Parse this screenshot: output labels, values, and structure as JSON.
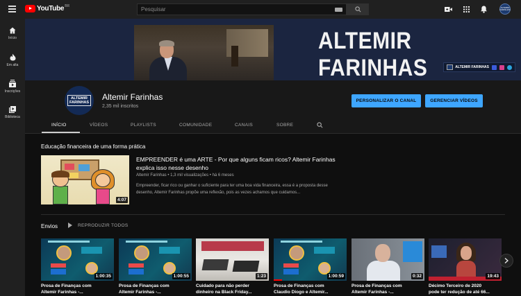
{
  "topbar": {
    "logo_text": "YouTube",
    "region": "BR",
    "search_placeholder": "Pesquisar",
    "avatar_text": "ALTEMIR FARINHAS"
  },
  "sidebar": {
    "items": [
      {
        "label": "Início",
        "icon": "home-icon"
      },
      {
        "label": "Em alta",
        "icon": "flame-icon"
      },
      {
        "label": "Inscrições",
        "icon": "subscriptions-icon"
      },
      {
        "label": "Biblioteca",
        "icon": "library-icon"
      }
    ]
  },
  "banner": {
    "name_line1": "ALTEMIR",
    "name_line2": "FARINHAS",
    "links_label": "ALTEMIR FARINHAS"
  },
  "channel": {
    "name": "Altemir Farinhas",
    "subscribers": "2,35 mil inscritos",
    "avatar_line1": "ALTEMIR",
    "avatar_line2": "FARINHAS",
    "customize_button": "PERSONALIZAR O CANAL",
    "manage_button": "GERENCIAR VÍDEOS"
  },
  "tabs": [
    "INÍCIO",
    "VÍDEOS",
    "PLAYLISTS",
    "COMUNIDADE",
    "CANAIS",
    "SOBRE"
  ],
  "featured": {
    "section_title": "Educação financeira de uma forma prática",
    "title": "EMPREENDER é uma ARTE - Por que alguns ficam ricos? Altemir Farinhas explica isso nesse desenho",
    "meta": "Altemir Farinhas • 1,3 mil visualizações • há 6 meses",
    "description_line1": "Empreender, ficar rico ou ganhar o suficiente para ter uma boa vida financeira, essa é a proposta desse",
    "description_line2": "desenho, Altemir Farinhas propõe uma reflexão, pois as vezes achamos que cuidamos...",
    "duration": "4:07"
  },
  "uploads": {
    "title": "Envios",
    "play_all": "REPRODUZIR TODOS",
    "videos": [
      {
        "title_line1": "Prosa de Finanças com",
        "title_line2": "Altemir Farinhas -...",
        "duration": "1:00:35",
        "style": "prosa"
      },
      {
        "title_line1": "Prosa de Finanças com",
        "title_line2": "Altemir Farinhas -...",
        "duration": "1:00:55",
        "style": "prosa"
      },
      {
        "title_line1": "Cuidado para não perder",
        "title_line2": "dinheiro na Black Friday...",
        "duration": "1:23",
        "style": "shop"
      },
      {
        "title_line1": "Prosa de Finanças com",
        "title_line2": "Claudio Diogo e Altemir...",
        "duration": "1:00:59",
        "style": "prosa"
      },
      {
        "title_line1": "Prosa de Finanças com",
        "title_line2": "Altemir Farinhas -...",
        "duration": "0:32",
        "style": "man"
      },
      {
        "title_line1": "Décimo Terceiro de 2020",
        "title_line2": "pode ter redução de até 66...",
        "duration": "19:43",
        "style": "news"
      }
    ]
  },
  "colors": {
    "accent_blue": "#3ea6ff",
    "youtube_red": "#ff0000",
    "background": "#181818"
  }
}
